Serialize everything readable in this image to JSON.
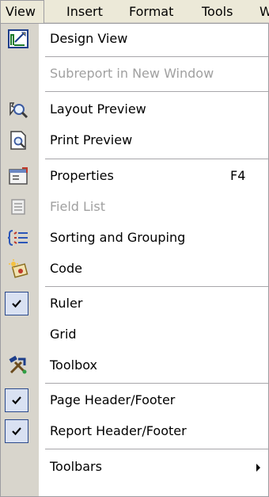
{
  "menubar": {
    "items": [
      {
        "label": "View"
      },
      {
        "label": "Insert"
      },
      {
        "label": "Format"
      },
      {
        "label": "Tools"
      },
      {
        "label": "W"
      }
    ]
  },
  "menu": {
    "items": [
      {
        "label": "Design View",
        "icon": "design-view-icon"
      },
      {
        "label": "Subreport in New Window",
        "disabled": true
      },
      {
        "label": "Layout Preview",
        "icon": "layout-preview-icon"
      },
      {
        "label": "Print Preview",
        "icon": "print-preview-icon"
      },
      {
        "label": "Properties",
        "shortcut": "F4",
        "icon": "properties-icon"
      },
      {
        "label": "Field List",
        "disabled": true,
        "icon": "field-list-icon"
      },
      {
        "label": "Sorting and Grouping",
        "icon": "sorting-grouping-icon"
      },
      {
        "label": "Code",
        "icon": "code-icon"
      },
      {
        "label": "Ruler",
        "checked": true
      },
      {
        "label": "Grid"
      },
      {
        "label": "Toolbox",
        "icon": "toolbox-icon"
      },
      {
        "label": "Page Header/Footer",
        "checked": true
      },
      {
        "label": "Report Header/Footer",
        "checked": true
      },
      {
        "label": "Toolbars",
        "submenu": true
      }
    ]
  },
  "colors": {
    "menubar": "#ece9d8",
    "gutter": "#d8d5cc",
    "disabled_text": "#a0a0a0",
    "check_bg": "#d9e1f2"
  }
}
